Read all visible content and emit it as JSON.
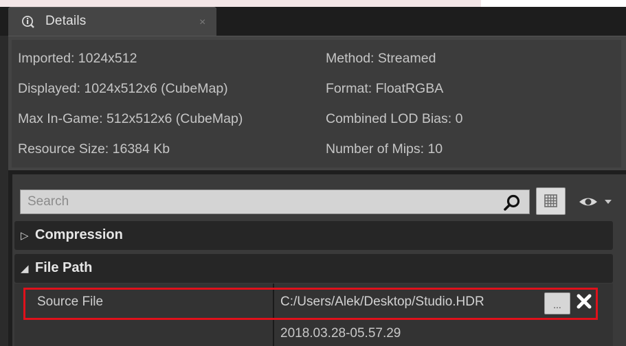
{
  "tab": {
    "title": "Details",
    "close_glyph": "×",
    "icon": "info-magnifier-icon"
  },
  "info": {
    "left": [
      "Imported: 1024x512",
      "Displayed: 1024x512x6 (CubeMap)",
      "Max In-Game: 512x512x6 (CubeMap)",
      "Resource Size: 16384 Kb"
    ],
    "right": [
      "Method: Streamed",
      "Format: FloatRGBA",
      "Combined LOD Bias: 0",
      "Number of Mips: 10"
    ]
  },
  "search": {
    "placeholder": "Search",
    "icon": "search-icon"
  },
  "toolbar": {
    "view_icon": "property-matrix-icon",
    "eye_icon": "eye-icon"
  },
  "categories": [
    {
      "label": "Compression",
      "arrow": "▷",
      "expanded": false
    },
    {
      "label": "File Path",
      "arrow": "◢",
      "expanded": true
    }
  ],
  "file_path": {
    "property_label": "Source File",
    "value": "C:/Users/Alek/Desktop/Studio.HDR",
    "timestamp": "2018.03.28-05.57.29",
    "browse_label": "...",
    "clear_icon": "close-icon"
  },
  "colors": {
    "highlight": "#e0111b",
    "panel": "#3c3c3c",
    "header": "#262626"
  }
}
